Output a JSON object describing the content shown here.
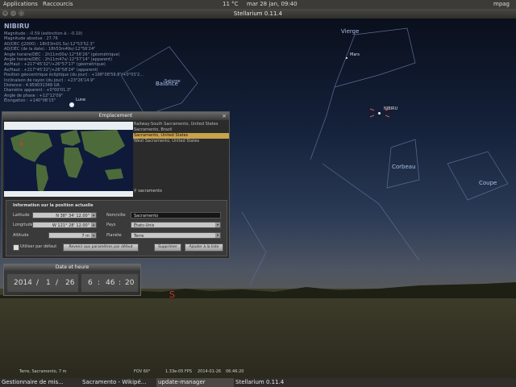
{
  "topbar": {
    "applications": "Applications",
    "raccourcis": "Raccourcis",
    "weather": "11 °C",
    "datetime": "mar 28 jan, 09:40",
    "user": "mpag"
  },
  "window": {
    "title": "Stellarium 0.11.4"
  },
  "object_info": {
    "name": "NIBIRU",
    "lines": [
      "Magnitude : -0.59 (extinction à : -0.19)",
      "Magnitude absolue : 27.76",
      "AD/DEC (J2000) : 18h53m01.5s/-12°53'52.3\"",
      "AD/DEC (de la date) : 18h53m49s/-12°56'24\"",
      "Angle horaire/DEC : 2h11m00s/-12°56'26\" (géométrique)",
      "Angle horaire/DEC : 2h11m47s/-12°57'14\" (apparent)",
      "Az/Haut : +217°45'32\"/+26°57'17\" (géométrique)",
      "Az/Haut : +217°45'32\"/+26°58'24\" (apparent)",
      "Position géocentrique écliptique (du jour) : +198°08'59.8\"/+0°03'2...",
      "Inclinaison de rayon (du jour) : +23°26'14.9\"",
      "Distance : 4.959031348 UA",
      "Diamètre apparent : +0°00'01.3\"",
      "Angle de phase : +12°12'09\"",
      "Élongation : +140°06'15\""
    ]
  },
  "sky_labels": {
    "vierge": "Vierge",
    "mars": "Mars",
    "saturne": "Saturne",
    "balance": "Balance",
    "lune": "Lune",
    "nibiru": "NIBIRU",
    "corbeau": "Corbeau",
    "coupe": "Coupe",
    "cardinal_s": "S"
  },
  "location_panel": {
    "title": "Emplacement",
    "close": "×",
    "list": [
      "Railway-South Sacramento, United States",
      "Sacramento, Brazil",
      "Sacramento, United States",
      "West Sacramento, United States"
    ],
    "selected_index": 2,
    "search_value": "sacramento",
    "section_title": "Information sur la position actuelle",
    "latitude_label": "Latitude",
    "latitude_value": "N 38° 34' 12.00\"",
    "longitude_label": "Longitude",
    "longitude_value": "W 121° 28' 12.00\"",
    "altitude_label": "Altitude",
    "altitude_value": "7 m",
    "name_label": "Nom/ville",
    "name_value": "Sacramento",
    "country_label": "Pays",
    "country_value": "États-Unis",
    "planet_label": "Planète",
    "planet_value": "Terre",
    "default_checkbox": "Utiliser par défaut",
    "reset_button": "Revenir aux paramètres par défaut",
    "delete_button": "Supprimer",
    "add_button": "Ajouter à la liste"
  },
  "datetime_panel": {
    "title": "Date et heure",
    "year": "2014",
    "month": "1",
    "day": "26",
    "hour": "6",
    "minute": "46",
    "second": "20"
  },
  "status": {
    "location": "Terre, Sacramento, 7 m",
    "fov": "FOV 60°",
    "fps": "1.33e-05 FPS",
    "date": "2014-01-26",
    "time": "06:46:20"
  },
  "taskbar": {
    "items": [
      "Gestionnaire de mis...",
      "Sacramento - Wikipé...",
      "update-manager",
      "Stellarium 0.11.4"
    ]
  }
}
